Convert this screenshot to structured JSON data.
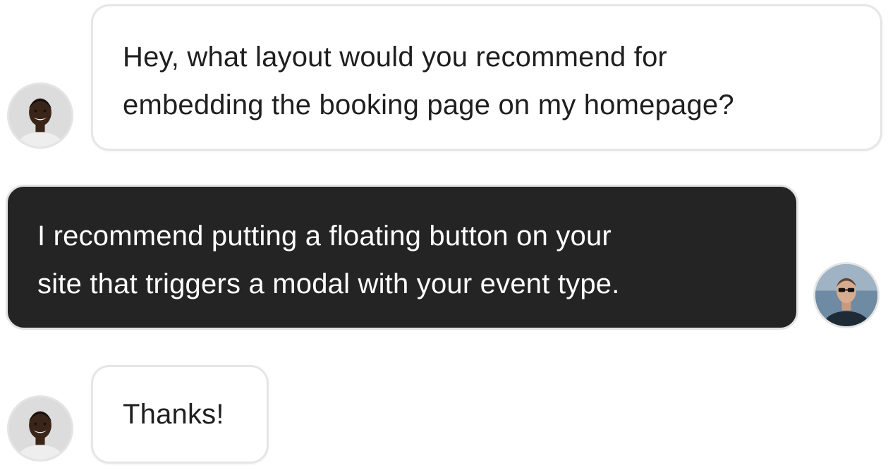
{
  "messages": [
    {
      "sender": "user",
      "lines": [
        "Hey, what layout would you recommend for",
        "embedding the booking page on my homepage?"
      ]
    },
    {
      "sender": "agent",
      "lines": [
        "I recommend putting a floating button on your",
        "site that triggers a modal with your event type."
      ]
    },
    {
      "sender": "user",
      "lines": [
        "Thanks!"
      ]
    }
  ],
  "colors": {
    "incoming_bubble": "#ffffff",
    "outgoing_bubble": "#242424",
    "bubble_border": "#e6e6e6",
    "text_dark": "#1f1f1f",
    "text_light": "#ffffff"
  }
}
